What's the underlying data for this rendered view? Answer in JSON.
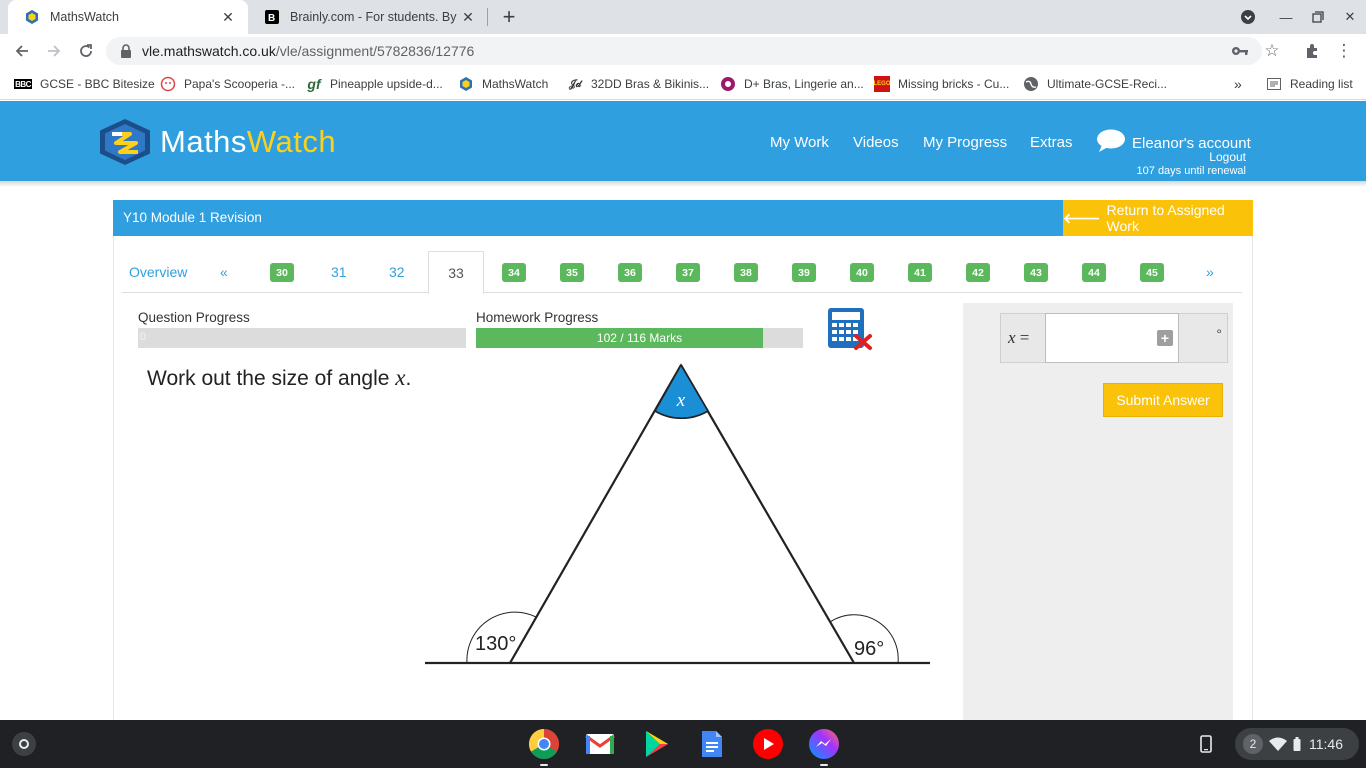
{
  "browser": {
    "tabs": [
      {
        "title": "MathsWatch",
        "active": true
      },
      {
        "title": "Brainly.com - For students. By st"
      }
    ],
    "url": {
      "host": "vle.mathswatch.co.uk",
      "path": "/vle/assignment/5782836/12776"
    },
    "bookmarks": [
      {
        "label": "GCSE - BBC Bitesize",
        "icon": "bbc-icon"
      },
      {
        "label": "Papa's Scooperia -...",
        "icon": "papas-icon"
      },
      {
        "label": "Pineapple upside-d...",
        "icon": "gf-icon"
      },
      {
        "label": "MathsWatch",
        "icon": "mathswatch-icon"
      },
      {
        "label": "32DD Bras & Bikinis...",
        "icon": "bras-icon"
      },
      {
        "label": "D+ Bras, Lingerie an...",
        "icon": "dplus-icon"
      },
      {
        "label": "Missing bricks - Cu...",
        "icon": "lego-icon"
      },
      {
        "label": "Ultimate-GCSE-Reci...",
        "icon": "globe-icon"
      }
    ],
    "bookmarks_overflow": "»",
    "reading_list": "Reading list"
  },
  "site": {
    "logo_part1": "Maths",
    "logo_part2": "Watch",
    "nav": [
      "My Work",
      "Videos",
      "My Progress",
      "Extras"
    ],
    "account": {
      "name": "Eleanor's account",
      "logout": "Logout",
      "renewal": "107 days until renewal"
    }
  },
  "module": {
    "title": "Y10 Module 1 Revision",
    "return_label": "Return to Assigned Work"
  },
  "question_nav": {
    "overview": "Overview",
    "prev": "«",
    "next": "»",
    "items": [
      "30",
      "31",
      "32",
      "33",
      "34",
      "35",
      "36",
      "37",
      "38",
      "39",
      "40",
      "41",
      "42",
      "43",
      "44",
      "45"
    ],
    "completed": [
      "30",
      "34",
      "35",
      "36",
      "37",
      "38",
      "39",
      "40",
      "41",
      "42",
      "43",
      "44",
      "45"
    ],
    "current": "33"
  },
  "progress": {
    "question_label": "Question Progress",
    "question_value": "0",
    "question_fraction": 0,
    "homework_label": "Homework Progress",
    "homework_text": "102 / 116 Marks",
    "homework_fraction": 0.879
  },
  "question": {
    "text": "Work out the size of angle",
    "var": "x",
    "end": ".",
    "diagram": {
      "apex_label": "x",
      "left_angle": "130°",
      "right_angle": "96°"
    }
  },
  "answer": {
    "label_var": "x",
    "label_eq": "=",
    "value": "",
    "unit": "°",
    "submit": "Submit Answer"
  },
  "shelf": {
    "apps": [
      "chrome-icon",
      "gmail-icon",
      "play-store-icon",
      "docs-icon",
      "youtube-icon",
      "messenger-icon"
    ],
    "notifications": "2",
    "time": "11:46"
  },
  "colors": {
    "brand_blue": "#2f9fe0",
    "accent_yellow": "#fbc20a",
    "success_green": "#5cb85c"
  }
}
